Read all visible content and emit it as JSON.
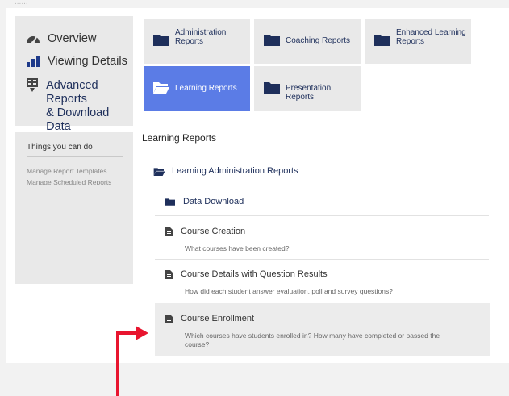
{
  "top_cut_text": "......",
  "nav": {
    "items": [
      {
        "label": "Overview",
        "icon": "dashboard-icon"
      },
      {
        "label": "Viewing Details",
        "icon": "bar-chart-icon"
      },
      {
        "label": "Advanced Reports & Download Data",
        "label_line1": "Advanced Reports",
        "label_line2": "& Download Data",
        "icon": "report-download-icon"
      }
    ]
  },
  "panel": {
    "title": "Things you can do",
    "links": [
      "Manage Report Templates",
      "Manage Scheduled Reports"
    ]
  },
  "tiles": [
    {
      "label_line1": "Administration",
      "label_line2": "Reports",
      "icon": "folder-icon"
    },
    {
      "label_line1": "Coaching Reports",
      "label_line2": "",
      "icon": "folder-icon"
    },
    {
      "label_line1": "Enhanced Learning",
      "label_line2": "Reports",
      "icon": "folder-icon"
    },
    {
      "label_line1": "Learning Reports",
      "label_line2": "",
      "icon": "folder-open-icon",
      "active": true
    },
    {
      "label_line1": "Presentation Reports",
      "label_line2": "",
      "icon": "folder-icon"
    }
  ],
  "section_title": "Learning Reports",
  "group": {
    "label": "Learning Administration Reports",
    "icon": "folder-open-icon"
  },
  "subgroup": {
    "label": "Data Download",
    "icon": "folder-icon"
  },
  "reports": [
    {
      "title": "Course Creation",
      "desc": "What courses have been created?",
      "icon": "document-icon"
    },
    {
      "title": "Course Details with Question Results",
      "desc": "How did each student answer evaluation, poll and survey questions?",
      "icon": "document-icon"
    },
    {
      "title": "Course Enrollment",
      "desc_line1": "Which courses have students enrolled in? How many have completed or passed the",
      "desc_line2": "course?",
      "icon": "document-icon",
      "highlighted": true
    }
  ],
  "colors": {
    "accent": "#5b7ce6",
    "navy": "#1e2f5b",
    "annotation_arrow": "#e8152f"
  }
}
